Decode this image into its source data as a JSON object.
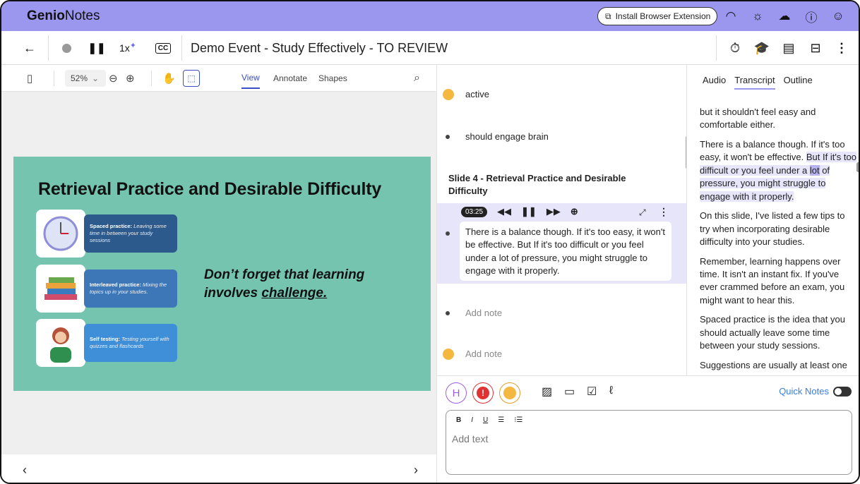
{
  "app": {
    "brand_bold": "Genio",
    "brand_rest": "Notes"
  },
  "topbar": {
    "extension_label": "Install Browser Extension",
    "icons": [
      "cast-icon",
      "sun-icon",
      "cloud-icon",
      "help-icon",
      "account-icon"
    ]
  },
  "toolbar": {
    "speed": "1x",
    "cc": "CC",
    "doc_title": "Demo Event - Study Effectively - TO REVIEW"
  },
  "pdf": {
    "zoom": "52%",
    "tabs": [
      "View",
      "Annotate",
      "Shapes"
    ],
    "slide": {
      "title": "Retrieval Practice and Desirable Difficulty",
      "cards": [
        {
          "bold": "Spaced practice:",
          "rest": " Leaving some time in between your study sessions",
          "color": "#2d5a8c"
        },
        {
          "bold": "Interleaved practice:",
          "rest": " Mixing the topics up in your studies.",
          "color": "#3d77b8"
        },
        {
          "bold": "Self testing:",
          "rest": " Testing yourself with quizzes and flashcards",
          "color": "#3f8ed8"
        }
      ],
      "quote_line1": "Don’t forget that learning",
      "quote_line2_pre": "involves ",
      "quote_line2_u": "challenge."
    }
  },
  "notes": {
    "item_active": "active",
    "item_engage": "should engage brain",
    "slide_heading": "Slide 4 - Retrieval Practice and Desirable Difficulty",
    "time": "03:25",
    "active_note": "There is a balance though. If it's too easy, it won't be effective. But If it's too difficult or you feel under a lot of pressure, you might struggle to engage with it properly.",
    "add_note_1": "Add note",
    "add_note_2": "Add note"
  },
  "editor": {
    "h_label": "H",
    "quick_notes": "Quick Notes",
    "format": [
      "B",
      "I",
      "U",
      "☰",
      "⁝☰"
    ],
    "placeholder": "Add text"
  },
  "transcript": {
    "tabs": [
      "Audio",
      "Transcript",
      "Outline"
    ],
    "active_tab": "Transcript",
    "p1": "but it shouldn't feel easy and comfortable either.",
    "p2_a": "There is a balance though. If it's too easy, it won't be effective. ",
    "p2_b": "But If it's too difficult or you feel under a ",
    "p2_c": "lot",
    "p2_d": " of pressure, you might struggle to engage with it properly.",
    "p3": "On this slide, I've listed a few tips to try when incorporating desirable difficulty into your studies.",
    "p4": "Remember, learning happens over time. It isn't an instant fix. If you've ever crammed before an exam, you might want to hear this.",
    "p5": "Spaced practice is the idea that you should actually leave some time between your study sessions.",
    "p6": "Suggestions are usually at least one"
  }
}
